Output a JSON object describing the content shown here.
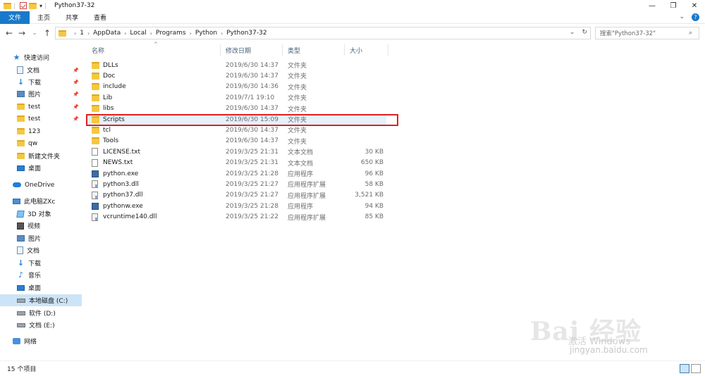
{
  "window": {
    "title": "Python37-32",
    "controls": [
      "—",
      "❐",
      "✕"
    ]
  },
  "ribbon": {
    "tabs": [
      {
        "label": "文件",
        "active": true
      },
      {
        "label": "主页",
        "active": false
      },
      {
        "label": "共享",
        "active": false
      },
      {
        "label": "查看",
        "active": false
      }
    ]
  },
  "address": {
    "breadcrumbs": [
      "1",
      "AppData",
      "Local",
      "Programs",
      "Python",
      "Python37-32"
    ],
    "search_placeholder": "搜索\"Python37-32\""
  },
  "navpane": {
    "items": [
      {
        "label": "快速访问",
        "icon": "star-icon",
        "level": 0,
        "pinned": false,
        "selected": false
      },
      {
        "label": "文档",
        "icon": "document-icon",
        "level": 1,
        "pinned": true,
        "selected": false
      },
      {
        "label": "下载",
        "icon": "download-icon",
        "level": 1,
        "pinned": true,
        "selected": false
      },
      {
        "label": "图片",
        "icon": "pictures-icon",
        "level": 1,
        "pinned": true,
        "selected": false
      },
      {
        "label": "test",
        "icon": "folder-icon",
        "level": 1,
        "pinned": true,
        "selected": false
      },
      {
        "label": "test",
        "icon": "folder-icon",
        "level": 1,
        "pinned": true,
        "selected": false
      },
      {
        "label": "123",
        "icon": "folder-icon",
        "level": 1,
        "pinned": false,
        "selected": false
      },
      {
        "label": "qw",
        "icon": "folder-icon",
        "level": 1,
        "pinned": false,
        "selected": false
      },
      {
        "label": "新建文件夹",
        "icon": "folder-icon",
        "level": 1,
        "pinned": false,
        "selected": false
      },
      {
        "label": "桌面",
        "icon": "desktop-icon",
        "level": 1,
        "pinned": false,
        "selected": false
      },
      {
        "label": "OneDrive",
        "icon": "onedrive-icon",
        "level": 0,
        "pinned": false,
        "selected": false
      },
      {
        "label": "此电脑ZXc",
        "icon": "pc-icon",
        "level": 0,
        "pinned": false,
        "selected": false
      },
      {
        "label": "3D 对象",
        "icon": "3d-objects-icon",
        "level": 1,
        "pinned": false,
        "selected": false
      },
      {
        "label": "视频",
        "icon": "video-icon",
        "level": 1,
        "pinned": false,
        "selected": false
      },
      {
        "label": "图片",
        "icon": "pictures-icon",
        "level": 1,
        "pinned": false,
        "selected": false
      },
      {
        "label": "文档",
        "icon": "document-icon",
        "level": 1,
        "pinned": false,
        "selected": false
      },
      {
        "label": "下载",
        "icon": "download-icon",
        "level": 1,
        "pinned": false,
        "selected": false
      },
      {
        "label": "音乐",
        "icon": "music-icon",
        "level": 1,
        "pinned": false,
        "selected": false
      },
      {
        "label": "桌面",
        "icon": "desktop-icon",
        "level": 1,
        "pinned": false,
        "selected": false
      },
      {
        "label": "本地磁盘 (C:)",
        "icon": "drive-icon",
        "level": 1,
        "pinned": false,
        "selected": true
      },
      {
        "label": "软件 (D:)",
        "icon": "drive-icon",
        "level": 1,
        "pinned": false,
        "selected": false
      },
      {
        "label": "文档 (E:)",
        "icon": "drive-icon",
        "level": 1,
        "pinned": false,
        "selected": false
      },
      {
        "label": "网络",
        "icon": "network-icon",
        "level": 0,
        "pinned": false,
        "selected": false
      }
    ]
  },
  "columns": {
    "name": "名称",
    "date": "修改日期",
    "type": "类型",
    "size": "大小"
  },
  "files": [
    {
      "name": "DLLs",
      "date": "2019/6/30 14:37",
      "type": "文件夹",
      "size": "",
      "kind": "folder"
    },
    {
      "name": "Doc",
      "date": "2019/6/30 14:37",
      "type": "文件夹",
      "size": "",
      "kind": "folder"
    },
    {
      "name": "include",
      "date": "2019/6/30 14:36",
      "type": "文件夹",
      "size": "",
      "kind": "folder"
    },
    {
      "name": "Lib",
      "date": "2019/7/1 19:10",
      "type": "文件夹",
      "size": "",
      "kind": "folder"
    },
    {
      "name": "libs",
      "date": "2019/6/30 14:37",
      "type": "文件夹",
      "size": "",
      "kind": "folder"
    },
    {
      "name": "Scripts",
      "date": "2019/6/30 15:09",
      "type": "文件夹",
      "size": "",
      "kind": "folder",
      "highlighted": true
    },
    {
      "name": "tcl",
      "date": "2019/6/30 14:37",
      "type": "文件夹",
      "size": "",
      "kind": "folder"
    },
    {
      "name": "Tools",
      "date": "2019/6/30 14:37",
      "type": "文件夹",
      "size": "",
      "kind": "folder"
    },
    {
      "name": "LICENSE.txt",
      "date": "2019/3/25 21:31",
      "type": "文本文档",
      "size": "30 KB",
      "kind": "txt"
    },
    {
      "name": "NEWS.txt",
      "date": "2019/3/25 21:31",
      "type": "文本文档",
      "size": "650 KB",
      "kind": "txt"
    },
    {
      "name": "python.exe",
      "date": "2019/3/25 21:28",
      "type": "应用程序",
      "size": "96 KB",
      "kind": "exe"
    },
    {
      "name": "python3.dll",
      "date": "2019/3/25 21:27",
      "type": "应用程序扩展",
      "size": "58 KB",
      "kind": "dll"
    },
    {
      "name": "python37.dll",
      "date": "2019/3/25 21:27",
      "type": "应用程序扩展",
      "size": "3,521 KB",
      "kind": "dll"
    },
    {
      "name": "pythonw.exe",
      "date": "2019/3/25 21:28",
      "type": "应用程序",
      "size": "94 KB",
      "kind": "exe"
    },
    {
      "name": "vcruntime140.dll",
      "date": "2019/3/25 21:22",
      "type": "应用程序扩展",
      "size": "85 KB",
      "kind": "dll"
    }
  ],
  "status": {
    "item_count": "15 个项目"
  },
  "watermark": {
    "logo": "Bai 经验",
    "line1": "激活 Windows",
    "line2": "jingyan.baidu.com"
  }
}
